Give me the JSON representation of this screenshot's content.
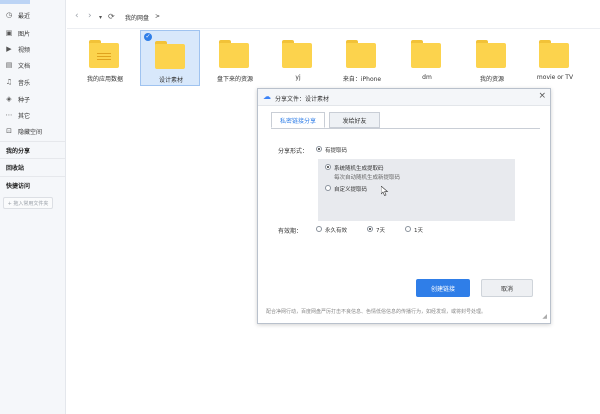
{
  "sidebar": {
    "items": [
      {
        "icon": "clock-icon",
        "label": "最近"
      },
      {
        "icon": "image-icon",
        "label": "图片"
      },
      {
        "icon": "video-icon",
        "label": "视频"
      },
      {
        "icon": "document-icon",
        "label": "文档"
      },
      {
        "icon": "music-icon",
        "label": "音乐"
      },
      {
        "icon": "seed-icon",
        "label": "种子"
      },
      {
        "icon": "more-icon",
        "label": "其它"
      },
      {
        "icon": "lock-icon",
        "label": "隐藏空间"
      }
    ],
    "my_share": "我的分享",
    "recycle_bin": "回收站",
    "quick_access": "快捷访问",
    "add_shortcut": "+ 拖入常用文件夹"
  },
  "topbar": {
    "back": "‹",
    "forward": "›",
    "dropdown": "▾",
    "refresh": "⟳",
    "path_root": "我的网盘",
    "path_sep": ">"
  },
  "folders": [
    {
      "name": "我的应用数据",
      "selected": false
    },
    {
      "name": "设计素材",
      "selected": true
    },
    {
      "name": "盘下来的资源",
      "selected": false
    },
    {
      "name": "yj",
      "selected": false
    },
    {
      "name": "来自：iPhone",
      "selected": false
    },
    {
      "name": "dm",
      "selected": false
    },
    {
      "name": "我的资源",
      "selected": false
    },
    {
      "name": "movie or TV",
      "selected": false
    }
  ],
  "dialog": {
    "title": "分享文件：设计素材",
    "close": "×",
    "tabs": [
      "私密链接分享",
      "发给好友"
    ],
    "share_form_label": "分享形式：",
    "with_code": "有提取码",
    "system_code": "系统随机生成提取码",
    "system_code_sub": "每次自动随机生成新提取码",
    "custom_code": "自定义提取码",
    "validity_label": "有效期：",
    "validity_options": [
      "永久有效",
      "7天",
      "1天"
    ],
    "validity_selected": "7天",
    "create_button": "创建链接",
    "cancel_button": "取消",
    "notice": "配合净网行动，百度网盘严厉打击不良信息、色情低俗信息的传播行为，如经发现，或将封号处理。"
  },
  "colors": {
    "accent": "#2f7ee8",
    "folder": "#fcd34d",
    "selection": "#d8e8fb"
  }
}
